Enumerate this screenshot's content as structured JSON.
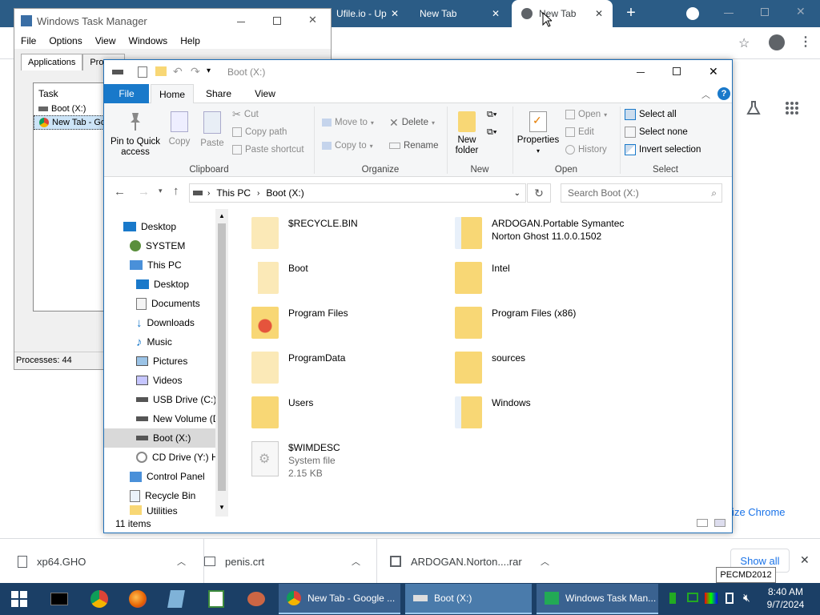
{
  "chrome": {
    "tabs": [
      {
        "label": "Ufile.io - Up"
      },
      {
        "label": "New Tab"
      },
      {
        "label": "New Tab"
      }
    ],
    "customize_label": "omize Chrome"
  },
  "taskmgr": {
    "title": "Windows Task Manager",
    "menu": [
      "File",
      "Options",
      "View",
      "Windows",
      "Help"
    ],
    "tabs": [
      "Applications",
      "Proces"
    ],
    "list_header": "Task",
    "tasks": [
      "Boot (X:)",
      "New Tab - Go"
    ],
    "status": "Processes: 44"
  },
  "explorer": {
    "title": "Boot (X:)",
    "ribbon_tabs": [
      "File",
      "Home",
      "Share",
      "View"
    ],
    "clipboard": {
      "pin": "Pin to Quick access",
      "copy": "Copy",
      "paste": "Paste",
      "cut": "Cut",
      "copy_path": "Copy path",
      "paste_shortcut": "Paste shortcut",
      "label": "Clipboard"
    },
    "organize": {
      "move_to": "Move to",
      "copy_to": "Copy to",
      "delete": "Delete",
      "rename": "Rename",
      "label": "Organize"
    },
    "new": {
      "new_folder": "New folder",
      "label": "New"
    },
    "open": {
      "properties": "Properties",
      "open": "Open",
      "edit": "Edit",
      "history": "History",
      "label": "Open"
    },
    "select": {
      "select_all": "Select all",
      "select_none": "Select none",
      "invert": "Invert selection",
      "label": "Select"
    },
    "address": {
      "crumbs": [
        "This PC",
        "Boot (X:)"
      ],
      "search_placeholder": "Search Boot (X:)"
    },
    "nav": [
      {
        "label": "Desktop"
      },
      {
        "label": "SYSTEM"
      },
      {
        "label": "This PC"
      },
      {
        "label": "Desktop"
      },
      {
        "label": "Documents"
      },
      {
        "label": "Downloads"
      },
      {
        "label": "Music"
      },
      {
        "label": "Pictures"
      },
      {
        "label": "Videos"
      },
      {
        "label": "USB Drive (C:)"
      },
      {
        "label": "New Volume (D"
      },
      {
        "label": "Boot (X:)"
      },
      {
        "label": "CD Drive (Y:) H"
      },
      {
        "label": "Control Panel"
      },
      {
        "label": "Recycle Bin"
      },
      {
        "label": "Utilities"
      }
    ],
    "files": [
      {
        "name": "$RECYCLE.BIN"
      },
      {
        "name": "ARDOGAN.Portable Symantec Norton Ghost 11.0.0.1502"
      },
      {
        "name": "Boot"
      },
      {
        "name": "Intel"
      },
      {
        "name": "Program Files"
      },
      {
        "name": "Program Files (x86)"
      },
      {
        "name": "ProgramData"
      },
      {
        "name": "sources"
      },
      {
        "name": "Users"
      },
      {
        "name": "Windows"
      },
      {
        "name": "$WIMDESC",
        "type": "System file",
        "size": "2.15 KB"
      }
    ],
    "status": "11 items"
  },
  "downloads": {
    "items": [
      {
        "name": "xp64.GHO"
      },
      {
        "name": "penis.crt"
      },
      {
        "name": "ARDOGAN.Norton....rar"
      }
    ],
    "show_all": "Show all"
  },
  "tooltip": "PECMD2012",
  "taskbar": {
    "tasks": [
      "New Tab - Google ...",
      "Boot (X:)",
      "Windows Task Man..."
    ],
    "time": "8:40 AM",
    "date": "9/7/2024"
  },
  "colors": {
    "taskbar": "#1b3f66",
    "ribbon_file_tab": "#1979ca",
    "folder": "#f8d775",
    "chrome_tabbar": "#dee1e6"
  }
}
